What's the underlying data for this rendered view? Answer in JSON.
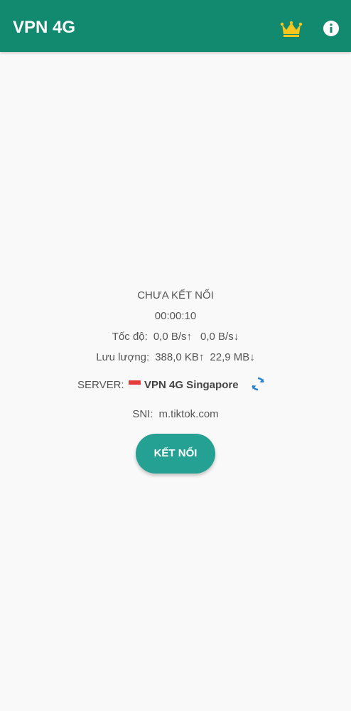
{
  "app_bar": {
    "title": "VPN 4G",
    "crown_icon": "crown-icon",
    "info_icon": "info-icon",
    "background_color": "#118a6f"
  },
  "status": {
    "connection_status": "CHƯA KẾT NỐI",
    "timer": "00:00:10"
  },
  "speed": {
    "label": "Tốc độ:",
    "upload": "0,0 B/s↑",
    "download": "0,0 B/s↓"
  },
  "traffic": {
    "label": "Lưu lượng:",
    "upload": "388,0 KB↑",
    "download": "22,9 MB↓"
  },
  "server": {
    "label": "SERVER:",
    "flag_icon": "singapore-flag-icon",
    "name": "VPN 4G Singapore",
    "refresh_icon": "refresh-icon"
  },
  "sni": {
    "label": "SNI:",
    "value": "m.tiktok.com"
  },
  "connect_button": {
    "label": "KẾT NỐI",
    "color": "#25a193"
  }
}
